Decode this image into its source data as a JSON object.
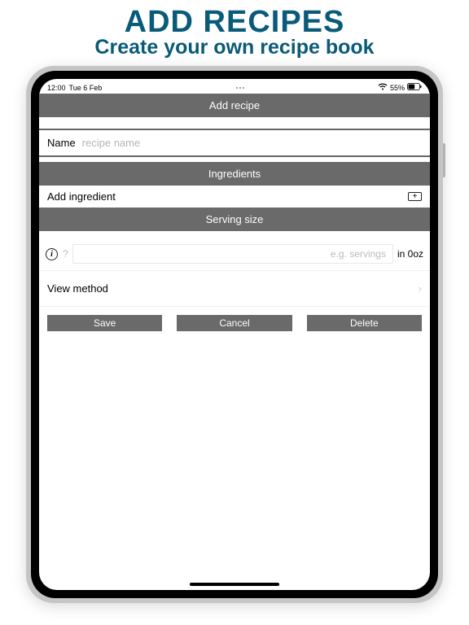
{
  "promo": {
    "title": "ADD RECIPES",
    "subtitle": "Create your own recipe book"
  },
  "status": {
    "time": "12:00",
    "date": "Tue 6 Feb",
    "battery_pct": "55%"
  },
  "headers": {
    "add_recipe": "Add recipe",
    "ingredients": "Ingredients",
    "serving_size": "Serving size"
  },
  "name_row": {
    "label": "Name",
    "placeholder": "recipe name"
  },
  "ingredients": {
    "add_label": "Add ingredient"
  },
  "serving": {
    "question": "?",
    "placeholder": "e.g. servings",
    "unit_text": "in 0oz"
  },
  "method": {
    "label": "View method"
  },
  "buttons": {
    "save": "Save",
    "cancel": "Cancel",
    "delete": "Delete"
  }
}
